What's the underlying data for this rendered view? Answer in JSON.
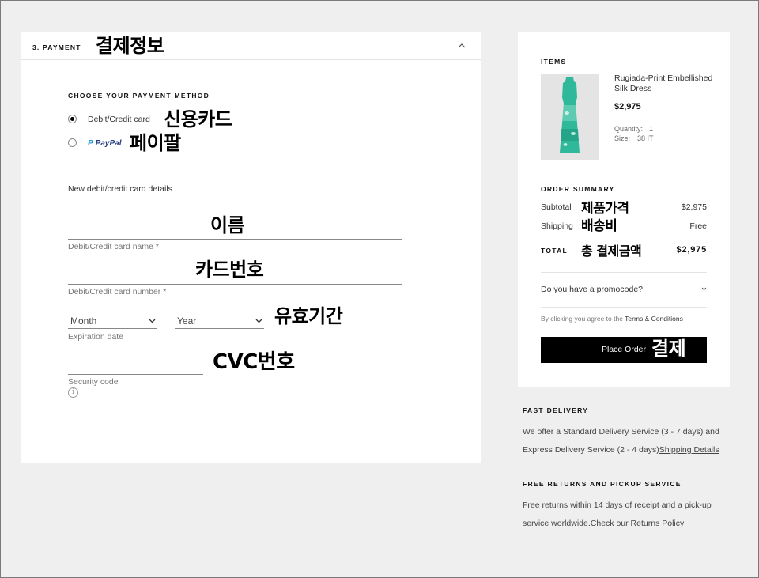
{
  "payment": {
    "section_label": "3. PAYMENT",
    "choose_method_label": "CHOOSE YOUR PAYMENT METHOD",
    "methods": [
      {
        "label": "Debit/Credit card",
        "selected": true
      },
      {
        "label": "PayPal",
        "selected": false
      }
    ],
    "card_details_title": "New debit/credit card details",
    "fields": {
      "name_caption": "Debit/Credit card name *",
      "number_caption": "Debit/Credit card number *",
      "month_value": "Month",
      "year_value": "Year",
      "expiration_caption": "Expiration date",
      "security_caption": "Security code"
    }
  },
  "order": {
    "items_label": "ITEMS",
    "product": {
      "name": "Rugiada-Print Embellished Silk Dress",
      "price": "$2,975",
      "quantity_label": "Quantity:",
      "quantity_value": "1",
      "size_label": "Size:",
      "size_value": "38 IT",
      "image_color": "#2fb89a"
    },
    "summary_label": "ORDER SUMMARY",
    "subtotal_label": "Subtotal",
    "subtotal_value": "$2,975",
    "shipping_label": "Shipping",
    "shipping_value": "Free",
    "total_label": "TOTAL",
    "total_value": "$2,975",
    "promo_label": "Do you have a promocode?",
    "terms_prefix": "By clicking you agree to the ",
    "terms_link": "Terms & Conditions",
    "place_order_label": "Place Order"
  },
  "info": {
    "fast_delivery_title": "FAST DELIVERY",
    "fast_delivery_text": "We offer a Standard Delivery Service (3 - 7 days) and Express Delivery Service (2 - 4 days)",
    "fast_delivery_link": "Shipping Details",
    "returns_title": "FREE RETURNS AND PICKUP SERVICE",
    "returns_text": "Free returns within 14 days of receipt and a pick-up service worldwide.",
    "returns_link": "Check our Returns Policy"
  },
  "annotations": {
    "payment_info": "결제정보",
    "credit_card": "신용카드",
    "paypal": "페이팔",
    "name": "이름",
    "card_number": "카드번호",
    "expiry": "유효기간",
    "cvc": "CVC번호",
    "product_price": "제품가격",
    "shipping_fee": "배송비",
    "total_payment": "총 결제금액",
    "checkout": "결제"
  }
}
